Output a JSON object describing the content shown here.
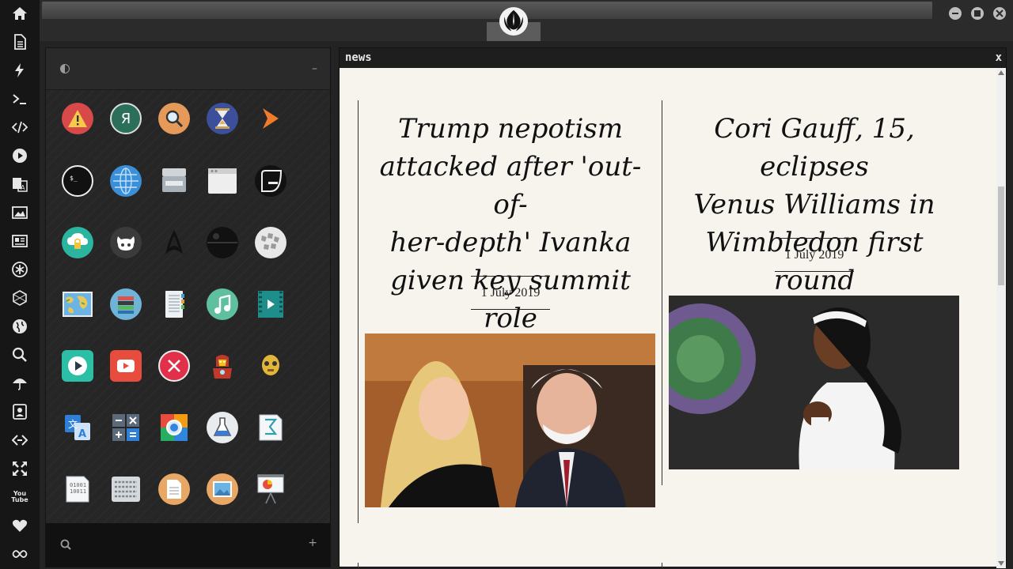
{
  "news_window": {
    "title": "news",
    "close_label": "x",
    "articles": [
      {
        "headline_lines": [
          "Trump nepotism",
          "attacked after 'out-of-",
          "her-depth' Ivanka",
          "given key summit role"
        ],
        "date": "1 July 2019"
      },
      {
        "headline_lines": [
          "Cori Gauff, 15, eclipses",
          "Venus Williams in",
          "Wimbledon first round"
        ],
        "date": "1 July 2019"
      }
    ]
  },
  "dock": {
    "icons": [
      "home-icon",
      "file-icon",
      "bolt-icon",
      "terminal-icon",
      "code-icon",
      "play-circle-icon",
      "translate-icon",
      "image-icon",
      "newspaper-icon",
      "asterisk-icon",
      "hexagon-icon",
      "globe-icon",
      "search-icon",
      "umbrella-icon",
      "contact-card-icon",
      "link-icon",
      "expand-icon",
      "youtube-icon",
      "heart-icon",
      "infinity-icon"
    ],
    "youtube_label": "You\nTube"
  },
  "launcher": {
    "apps": [
      "warning-app",
      "yandex-app",
      "search-app",
      "hourglass-app",
      "terminal-arrow-app",
      "terminal-app",
      "globe-app",
      "scanner-app",
      "window-app",
      "console-app",
      "cloud-lock-app",
      "github-app",
      "starfleet-app",
      "death-star-app",
      "wikipedia-app",
      "map-app",
      "books-app",
      "notes-app",
      "music-app",
      "video-app",
      "media-player-app",
      "youtube-app",
      "close-app",
      "iron-man-app",
      "c3po-app",
      "translate-app",
      "calculator-app",
      "photos-app",
      "lab-app",
      "math-app",
      "binary-app",
      "keyboard-app",
      "document-app",
      "image-viewer-app",
      "presentation-app"
    ]
  },
  "colors": {
    "accent_teal": "#2bb5a0",
    "news_bg": "#f7f4ee",
    "dock_bg": "#161616"
  }
}
